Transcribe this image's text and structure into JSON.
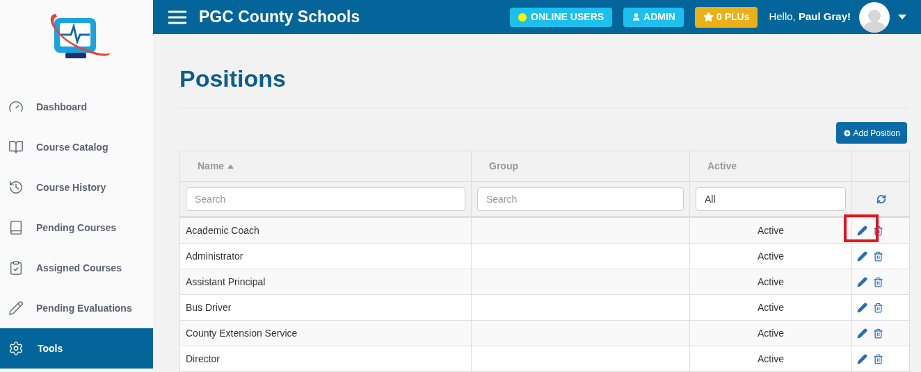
{
  "sidebar": {
    "items": [
      {
        "label": "Dashboard",
        "selected": false
      },
      {
        "label": "Course Catalog",
        "selected": false
      },
      {
        "label": "Course History",
        "selected": false
      },
      {
        "label": "Pending Courses",
        "selected": false
      },
      {
        "label": "Assigned Courses",
        "selected": false
      },
      {
        "label": "Pending Evaluations",
        "selected": false
      },
      {
        "label": "Tools",
        "selected": true
      }
    ]
  },
  "topbar": {
    "title": "PGC County Schools",
    "online_users": "ONLINE USERS",
    "admin": "ADMIN",
    "plus": "0 PLUs",
    "greeting": "Hello,",
    "user": "Paul Gray!"
  },
  "page": {
    "title": "Positions",
    "add_button": "Add Position"
  },
  "table": {
    "columns": [
      {
        "label": "Name",
        "sorted": true
      },
      {
        "label": "Group",
        "sorted": false
      },
      {
        "label": "Active",
        "sorted": false
      }
    ],
    "filters": [
      {
        "placeholder": "Search"
      },
      {
        "placeholder": "Search"
      },
      {
        "value": "All"
      }
    ],
    "rows": [
      {
        "name": "Academic Coach",
        "status": "Active",
        "highlighted": true
      },
      {
        "name": "Administrator",
        "status": "Active",
        "highlighted": false
      },
      {
        "name": "Assistant Principal",
        "status": "Active",
        "highlighted": false
      },
      {
        "name": "Bus Driver",
        "status": "Active",
        "highlighted": false
      },
      {
        "name": "County Extension Service",
        "status": "Active",
        "highlighted": false
      },
      {
        "name": "Director",
        "status": "Active",
        "highlighted": false
      }
    ]
  }
}
